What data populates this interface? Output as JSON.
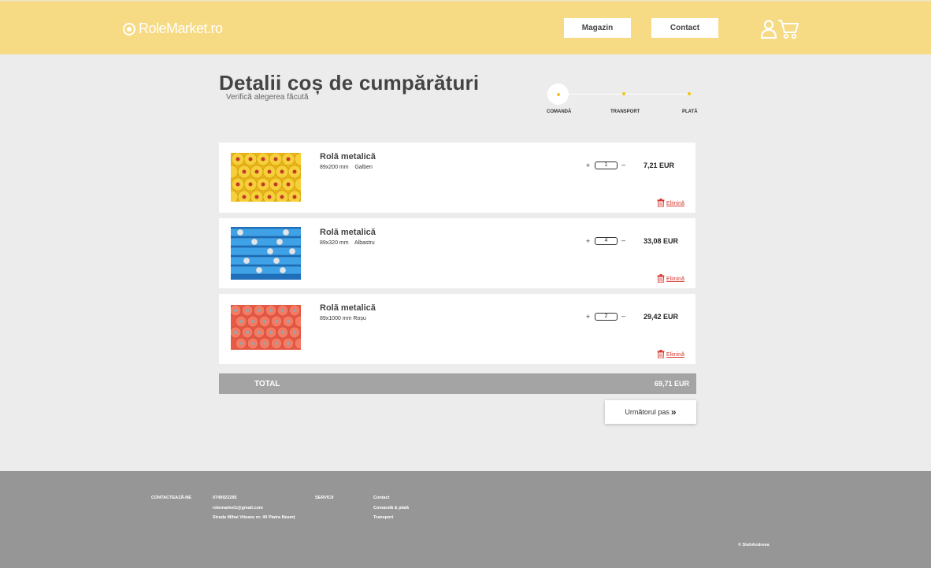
{
  "header": {
    "logo_text": "RoleMarket.ro",
    "nav": {
      "magazin": "Magazin",
      "contact": "Contact"
    },
    "icons": {
      "user": "user-icon",
      "cart": "cart-icon"
    }
  },
  "page": {
    "title": "Detalii coș de cumpărături",
    "subtitle": "Verifică alegerea făcută"
  },
  "stepper": {
    "steps": [
      "COMANDĂ",
      "TRANSPORT",
      "PLATĂ"
    ],
    "active_step": "COMANDĂ"
  },
  "cart": {
    "items": [
      {
        "name": "Rolă metalică",
        "spec": "89x200 mm    Galben",
        "quantity": "1",
        "price": "7,21 EUR",
        "remove_label": "Elimină",
        "color": "#f3c626"
      },
      {
        "name": "Rolă metalică",
        "spec": "89x320 mm    Albastru",
        "quantity": "4",
        "price": "33,08 EUR",
        "remove_label": "Elimină",
        "color": "#2e86d4"
      },
      {
        "name": "Rolă metalică",
        "spec": "89x1000 mm Roșu",
        "quantity": "2",
        "price": "29,42 EUR",
        "remove_label": "Elimină",
        "color": "#f06a52"
      }
    ],
    "qty_plus": "+",
    "qty_minus": "–",
    "total_label": "TOTAL",
    "total_value": "69,71 EUR",
    "next_label": "Următorul pas",
    "next_icon": "»"
  },
  "footer": {
    "contact_heading": "CONTACTEAZĂ-NE",
    "phone": "0749922285",
    "email": "rolemarket1@gmail.com",
    "address": "Strada Mihai Viteazu nr. 40 Piatra Neamț",
    "services_heading": "SERVICII",
    "services": [
      "Contact",
      "Comandă & plată",
      "Transport"
    ],
    "copyright": "© StehAndreea"
  },
  "colors": {
    "header_bg": "#f6da84",
    "accent": "#f5c518",
    "footer_bg": "#969696",
    "remove_red": "#d8362c"
  }
}
